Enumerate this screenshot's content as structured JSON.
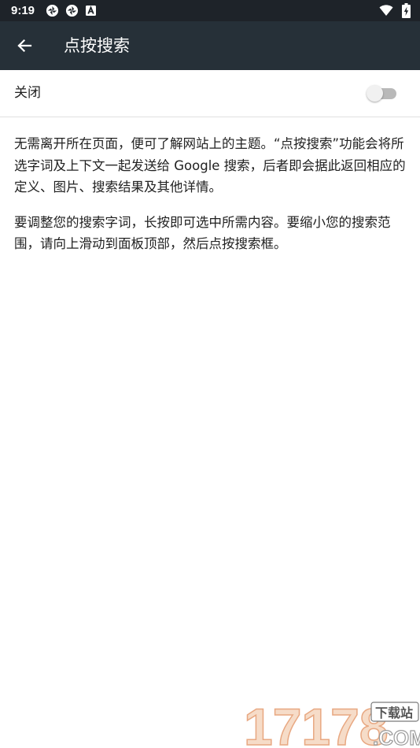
{
  "status_bar": {
    "time": "9:19",
    "icons_left": [
      "app-notification-icon",
      "app-notification-icon",
      "a-badge-icon"
    ],
    "icons_right": [
      "wifi-icon",
      "battery-charging-icon"
    ]
  },
  "app_bar": {
    "back_icon": "arrow-back-icon",
    "title": "点按搜索"
  },
  "toggle": {
    "label": "关闭",
    "state": false
  },
  "description": {
    "paragraph1": "无需离开所在页面，便可了解网站上的主题。“点按搜索”功能会将所选字词及上下文一起发送给 Google 搜索，后者即会据此返回相应的定义、图片、搜索结果及其他详情。",
    "paragraph2": "要调整您的搜索字词，长按即可选中所需内容。要缩小您的搜索范围，请向上滑动到面板顶部，然后点按搜索框。"
  },
  "watermark": {
    "number": "17178",
    "site_label": "下载站",
    "domain": ".COM"
  },
  "colors": {
    "status_bar_bg": "#1e2329",
    "app_bar_bg": "#263038",
    "toggle_track_off": "#b9b9b9",
    "toggle_thumb_off": "#f1f1f1",
    "text_primary": "#212121",
    "divider": "#e0e0e0"
  }
}
